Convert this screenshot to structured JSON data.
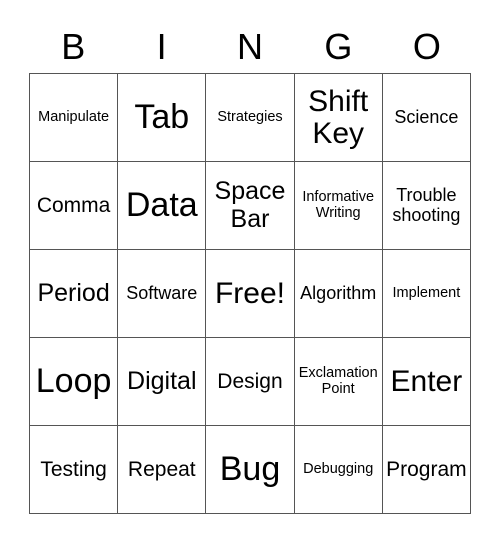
{
  "header": [
    "B",
    "I",
    "N",
    "G",
    "O"
  ],
  "cells": [
    {
      "text": "Manipulate",
      "size": "s1"
    },
    {
      "text": "Tab",
      "size": "s6"
    },
    {
      "text": "Strategies",
      "size": "s1"
    },
    {
      "text": "Shift\nKey",
      "size": "s5"
    },
    {
      "text": "Science",
      "size": "s2"
    },
    {
      "text": "Comma",
      "size": "s3"
    },
    {
      "text": "Data",
      "size": "s6"
    },
    {
      "text": "Space\nBar",
      "size": "s4"
    },
    {
      "text": "Informative\nWriting",
      "size": "s1"
    },
    {
      "text": "Trouble\nshooting",
      "size": "s2"
    },
    {
      "text": "Period",
      "size": "s4"
    },
    {
      "text": "Software",
      "size": "s2"
    },
    {
      "text": "Free!",
      "size": "s5"
    },
    {
      "text": "Algorithm",
      "size": "s2"
    },
    {
      "text": "Implement",
      "size": "s1"
    },
    {
      "text": "Loop",
      "size": "s6"
    },
    {
      "text": "Digital",
      "size": "s4"
    },
    {
      "text": "Design",
      "size": "s3"
    },
    {
      "text": "Exclamation\nPoint",
      "size": "s1"
    },
    {
      "text": "Enter",
      "size": "s5"
    },
    {
      "text": "Testing",
      "size": "s3"
    },
    {
      "text": "Repeat",
      "size": "s3"
    },
    {
      "text": "Bug",
      "size": "s6"
    },
    {
      "text": "Debugging",
      "size": "s1"
    },
    {
      "text": "Program",
      "size": "s3"
    }
  ]
}
